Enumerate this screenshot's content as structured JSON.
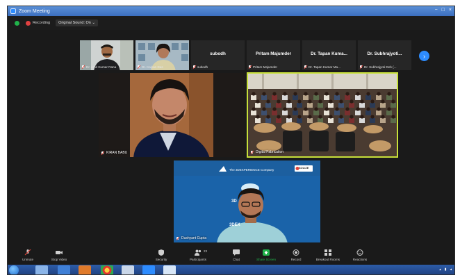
{
  "window": {
    "title": "Zoom Meeting",
    "controls": [
      "−",
      "□",
      "×"
    ]
  },
  "recording": {
    "label": "Recording",
    "original_sound": "Original Sound: On"
  },
  "participants_strip": [
    {
      "label": "Dr. Amit Kumar Rana",
      "type": "video"
    },
    {
      "label": "Dr. Kalyan Das",
      "type": "video"
    },
    {
      "name": "subodh",
      "label": "subodh",
      "type": "name"
    },
    {
      "name": "Pritam Majumder",
      "label": "Pritam Majumder",
      "type": "name"
    },
    {
      "name": "Dr. Tapan Kuma...",
      "label": "Dr. Tapan Kumar Ma...",
      "type": "name"
    },
    {
      "name": "Dr. Subhrajyoti...",
      "label": "Dr. Subhrajyoti Deb (...",
      "type": "name"
    }
  ],
  "videos": {
    "kiran": {
      "label": "KIRAN BABU"
    },
    "classroom": {
      "label": "Digital Fabrication"
    },
    "presenter": {
      "label": "Dushyant Gupta",
      "slide_brand": "The 3DEXPERIENCE Company",
      "slide_partner": "SOLIZE",
      "slide_text_1": "3D",
      "slide_text_2": "3DEX"
    }
  },
  "toolbar": {
    "unmute": "Unmute",
    "stop_video": "Stop Video",
    "security": "Security",
    "participants": "Participants",
    "participants_count": "23",
    "chat": "Chat",
    "share_screen": "Share Screen",
    "record": "Record",
    "breakout": "Breakout Rooms",
    "reactions": "Reactions"
  },
  "colors": {
    "accent_blue": "#2d8cff",
    "active_speaker": "#c8e03a",
    "share_green": "#21b34b",
    "muted_red": "#e0443a"
  }
}
